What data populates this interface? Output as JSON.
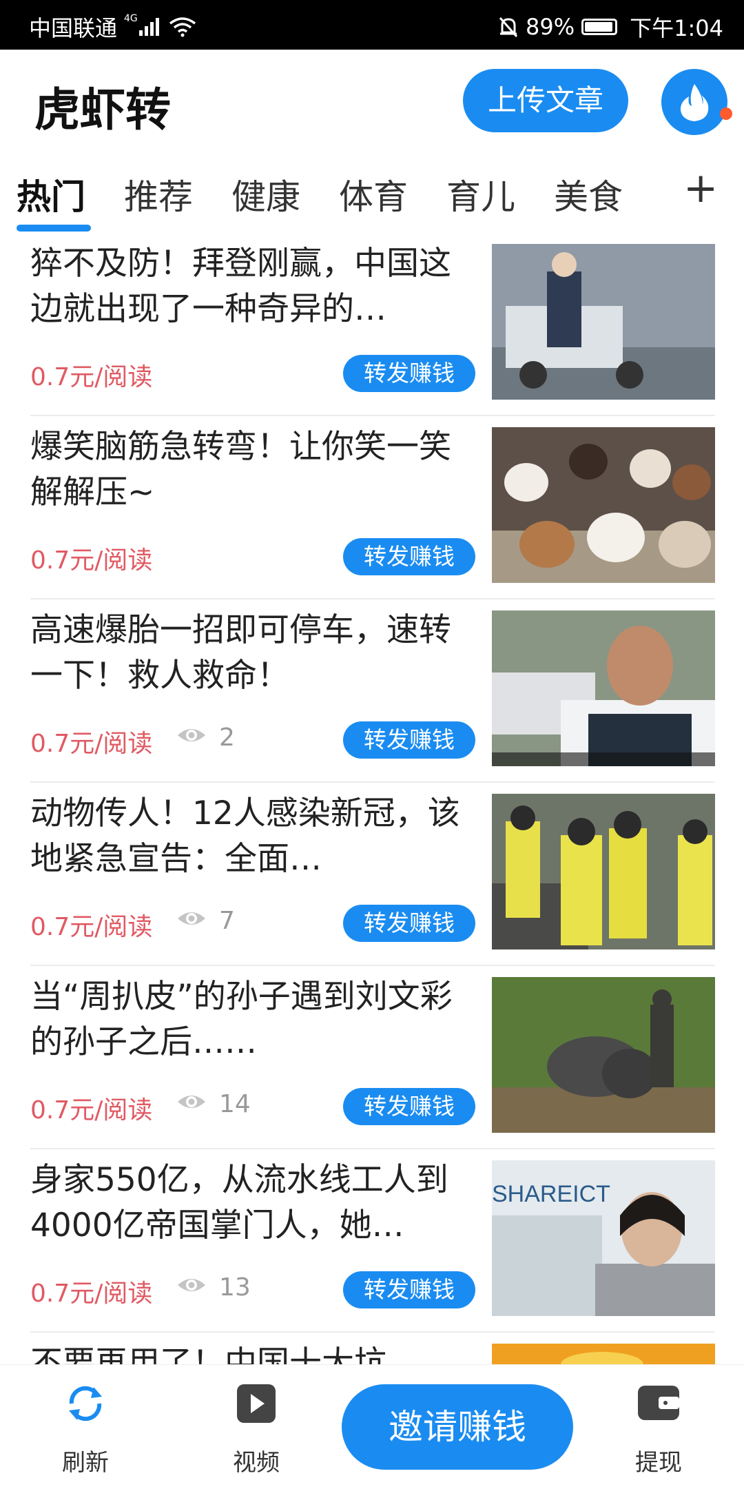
{
  "status_bar": {
    "carrier": "中国联通",
    "network": "4G",
    "battery": "89%",
    "time": "下午1:04"
  },
  "header": {
    "title": "虎虾转",
    "upload_label": "上传文章",
    "fire_icon": "flame-icon",
    "accent_color": "#1a8cf1",
    "notification_dot_color": "#ff5b2e"
  },
  "tabs": {
    "items": [
      "热门",
      "推荐",
      "健康",
      "体育",
      "育儿",
      "美食"
    ],
    "active_index": 0,
    "add_label": "+"
  },
  "feed": {
    "items": [
      {
        "title": "猝不及防！拜登刚赢，中国这边就出现了一种奇异的…",
        "price": "0.7元/阅读",
        "views": "",
        "share_label": "转发赚钱"
      },
      {
        "title": "爆笑脑筋急转弯！让你笑一笑解解压~",
        "price": "0.7元/阅读",
        "views": "",
        "share_label": "转发赚钱"
      },
      {
        "title": "高速爆胎一招即可停车，速转一下！救人救命！",
        "price": "0.7元/阅读",
        "views": "2",
        "share_label": "转发赚钱"
      },
      {
        "title": "动物传人！12人感染新冠，该地紧急宣告：全面…",
        "price": "0.7元/阅读",
        "views": "7",
        "share_label": "转发赚钱"
      },
      {
        "title": "当“周扒皮”的孙子遇到刘文彩的孙子之后……",
        "price": "0.7元/阅读",
        "views": "14",
        "share_label": "转发赚钱"
      },
      {
        "title": "身家550亿，从流水线工人到4000亿帝国掌门人，她…",
        "price": "0.7元/阅读",
        "views": "13",
        "share_label": "转发赚钱"
      },
      {
        "title": "不要再用了！中国十大坑",
        "price": "",
        "views": "",
        "share_label": ""
      }
    ],
    "thumb_overlay_text": "SHAREICT"
  },
  "bottom_nav": {
    "refresh_label": "刷新",
    "video_label": "视频",
    "invite_label": "邀请赚钱",
    "withdraw_label": "提现"
  }
}
